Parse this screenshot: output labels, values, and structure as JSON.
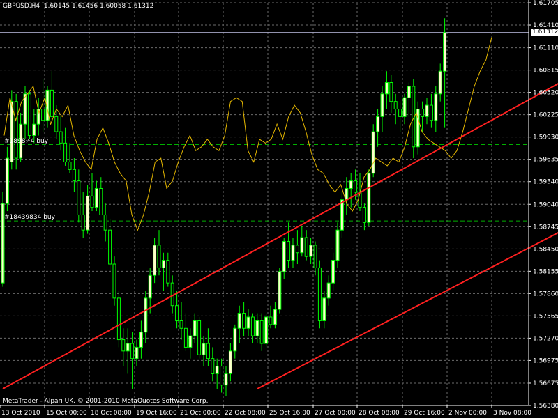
{
  "header": {
    "symbol": "GBPUSD,H4",
    "ohlc": "1.60145 1.61456 1.60058 1.61312"
  },
  "footer": {
    "copyright": "MetaTrader - Alpari UK, © 2001-2010 MetaQuotes Software Corp."
  },
  "bid": {
    "value": "1.61312",
    "price": 1.61312
  },
  "orders": [
    {
      "label": "#1898·⁄·4 buy",
      "price": 1.5983
    },
    {
      "label": "#18439834 buy",
      "price": 1.5882
    }
  ],
  "colors": {
    "background": "#000000",
    "grid": "#6b6b6b",
    "bull_candle": "#ffffcc",
    "bear_candle": "#000000",
    "wick": "#00ff00",
    "indicator": "#e6b800",
    "trendline": "#ff2020",
    "order_line": "#00b000",
    "bid_line": "#a7a7c7",
    "axis_text": "#ffffff"
  },
  "chart_data": {
    "type": "candlestick",
    "symbol": "GBPUSD",
    "timeframe": "H4",
    "y_ticks": [
      "1.61705",
      "1.61410",
      "1.61110",
      "1.60815",
      "1.60520",
      "1.60225",
      "1.59930",
      "1.59635",
      "1.59340",
      "1.59040",
      "1.58745",
      "1.58450",
      "1.58155",
      "1.57860",
      "1.57565",
      "1.57270",
      "1.56975",
      "1.56675",
      "1.56380"
    ],
    "y_range": [
      1.5638,
      1.61705
    ],
    "x_ticks": [
      "13 Oct 2010",
      "15 Oct 00:00",
      "18 Oct 08:00",
      "19 Oct 16:00",
      "21 Oct 00:00",
      "22 Oct 08:00",
      "25 Oct 16:00",
      "27 Oct 00:00",
      "28 Oct 08:00",
      "29 Oct 16:00",
      "2 Nov 00:00",
      "3 Nov 08:00"
    ],
    "candles": [
      [
        1.58,
        1.592,
        1.5795,
        1.5905
      ],
      [
        1.5905,
        1.598,
        1.5895,
        1.5965
      ],
      [
        1.596,
        1.6055,
        1.595,
        1.604
      ],
      [
        1.604,
        1.605,
        1.595,
        1.5965
      ],
      [
        1.5965,
        1.6025,
        1.596,
        1.601
      ],
      [
        1.601,
        1.606,
        1.599,
        1.605
      ],
      [
        1.605,
        1.6055,
        1.599,
        1.5995
      ],
      [
        1.5995,
        1.603,
        1.5985,
        1.601
      ],
      [
        1.601,
        1.6045,
        1.5995,
        1.603
      ],
      [
        1.603,
        1.607,
        1.6,
        1.6015
      ],
      [
        1.6015,
        1.606,
        1.6005,
        1.6055
      ],
      [
        1.6055,
        1.608,
        1.601,
        1.602
      ],
      [
        1.602,
        1.6035,
        1.599,
        1.6
      ],
      [
        1.6,
        1.602,
        1.5975,
        1.5985
      ],
      [
        1.5985,
        1.6005,
        1.5955,
        1.596
      ],
      [
        1.596,
        1.5985,
        1.5945,
        1.595
      ],
      [
        1.595,
        1.5965,
        1.592,
        1.5935
      ],
      [
        1.5935,
        1.595,
        1.588,
        1.589
      ],
      [
        1.589,
        1.592,
        1.586,
        1.587
      ],
      [
        1.587,
        1.593,
        1.5865,
        1.5915
      ],
      [
        1.5915,
        1.5945,
        1.5895,
        1.59
      ],
      [
        1.59,
        1.5935,
        1.5895,
        1.5925
      ],
      [
        1.5925,
        1.594,
        1.589,
        1.589
      ],
      [
        1.589,
        1.5905,
        1.5855,
        1.587
      ],
      [
        1.587,
        1.5885,
        1.5815,
        1.5825
      ],
      [
        1.5825,
        1.5835,
        1.577,
        1.578
      ],
      [
        1.578,
        1.579,
        1.5715,
        1.5725
      ],
      [
        1.5725,
        1.574,
        1.569,
        1.571
      ],
      [
        1.571,
        1.574,
        1.568,
        1.572
      ],
      [
        1.572,
        1.5735,
        1.566,
        1.57
      ],
      [
        1.57,
        1.5725,
        1.569,
        1.5715
      ],
      [
        1.5715,
        1.575,
        1.57,
        1.5735
      ],
      [
        1.5735,
        1.579,
        1.572,
        1.578
      ],
      [
        1.578,
        1.582,
        1.576,
        1.581
      ],
      [
        1.581,
        1.586,
        1.58,
        1.585
      ],
      [
        1.585,
        1.587,
        1.581,
        1.582
      ],
      [
        1.582,
        1.584,
        1.579,
        1.583
      ],
      [
        1.583,
        1.584,
        1.5795,
        1.58
      ],
      [
        1.58,
        1.581,
        1.576,
        1.577
      ],
      [
        1.577,
        1.579,
        1.574,
        1.575
      ],
      [
        1.575,
        1.5775,
        1.5725,
        1.574
      ],
      [
        1.574,
        1.576,
        1.571,
        1.5715
      ],
      [
        1.5715,
        1.574,
        1.57,
        1.573
      ],
      [
        1.573,
        1.576,
        1.572,
        1.575
      ],
      [
        1.575,
        1.5755,
        1.57,
        1.5705
      ],
      [
        1.5705,
        1.573,
        1.569,
        1.572
      ],
      [
        1.572,
        1.574,
        1.569,
        1.57
      ],
      [
        1.57,
        1.5715,
        1.567,
        1.568
      ],
      [
        1.568,
        1.57,
        1.566,
        1.569
      ],
      [
        1.569,
        1.57,
        1.5655,
        1.5665
      ],
      [
        1.5665,
        1.569,
        1.565,
        1.568
      ],
      [
        1.568,
        1.572,
        1.567,
        1.571
      ],
      [
        1.571,
        1.5745,
        1.57,
        1.574
      ],
      [
        1.574,
        1.577,
        1.572,
        1.576
      ],
      [
        1.576,
        1.5775,
        1.573,
        1.574
      ],
      [
        1.574,
        1.5765,
        1.573,
        1.5755
      ],
      [
        1.5755,
        1.576,
        1.572,
        1.573
      ],
      [
        1.573,
        1.576,
        1.572,
        1.575
      ],
      [
        1.575,
        1.576,
        1.571,
        1.572
      ],
      [
        1.572,
        1.576,
        1.5715,
        1.5755
      ],
      [
        1.5755,
        1.577,
        1.574,
        1.5745
      ],
      [
        1.5745,
        1.5775,
        1.574,
        1.5765
      ],
      [
        1.5765,
        1.582,
        1.576,
        1.5815
      ],
      [
        1.5815,
        1.586,
        1.5805,
        1.5855
      ],
      [
        1.5855,
        1.588,
        1.582,
        1.583
      ],
      [
        1.583,
        1.586,
        1.582,
        1.585
      ],
      [
        1.585,
        1.587,
        1.5825,
        1.584
      ],
      [
        1.584,
        1.5875,
        1.5835,
        1.586
      ],
      [
        1.586,
        1.587,
        1.583,
        1.5835
      ],
      [
        1.5835,
        1.586,
        1.5825,
        1.585
      ],
      [
        1.585,
        1.5855,
        1.581,
        1.582
      ],
      [
        1.582,
        1.583,
        1.574,
        1.575
      ],
      [
        1.575,
        1.579,
        1.574,
        1.578
      ],
      [
        1.578,
        1.581,
        1.577,
        1.58
      ],
      [
        1.58,
        1.584,
        1.579,
        1.583
      ],
      [
        1.583,
        1.588,
        1.582,
        1.587
      ],
      [
        1.587,
        1.592,
        1.586,
        1.591
      ],
      [
        1.591,
        1.594,
        1.589,
        1.5925
      ],
      [
        1.5925,
        1.5945,
        1.59,
        1.5935
      ],
      [
        1.5935,
        1.595,
        1.591,
        1.592
      ],
      [
        1.592,
        1.5945,
        1.5895,
        1.59
      ],
      [
        1.59,
        1.5905,
        1.587,
        1.588
      ],
      [
        1.588,
        1.595,
        1.5875,
        1.5945
      ],
      [
        1.5945,
        1.601,
        1.594,
        1.6
      ],
      [
        1.6,
        1.603,
        1.598,
        1.602
      ],
      [
        1.602,
        1.606,
        1.6,
        1.605
      ],
      [
        1.605,
        1.608,
        1.603,
        1.6065
      ],
      [
        1.6065,
        1.6075,
        1.6025,
        1.604
      ],
      [
        1.604,
        1.605,
        1.601,
        1.603
      ],
      [
        1.603,
        1.604,
        1.6,
        1.602
      ],
      [
        1.602,
        1.605,
        1.601,
        1.6045
      ],
      [
        1.6045,
        1.6065,
        1.602,
        1.606
      ],
      [
        1.606,
        1.607,
        1.5965,
        1.598
      ],
      [
        1.598,
        1.604,
        1.597,
        1.603
      ],
      [
        1.603,
        1.604,
        1.6,
        1.602
      ],
      [
        1.602,
        1.6045,
        1.601,
        1.6035
      ],
      [
        1.6035,
        1.605,
        1.6005,
        1.6015
      ],
      [
        1.6015,
        1.606,
        1.6,
        1.605
      ],
      [
        1.605,
        1.609,
        1.604,
        1.608
      ],
      [
        1.608,
        1.615,
        1.6005,
        1.6131
      ]
    ],
    "indicator_line": [
      1.5995,
      1.6045,
      1.6015,
      1.604,
      1.605,
      1.606,
      1.6025,
      1.6045,
      1.601,
      1.603,
      1.602,
      1.6035,
      1.5995,
      1.5975,
      1.596,
      1.595,
      1.599,
      1.6005,
      1.5985,
      1.596,
      1.5945,
      1.5935,
      1.589,
      1.587,
      1.589,
      1.592,
      1.596,
      1.5965,
      1.5925,
      1.5935,
      1.596,
      1.598,
      1.5995,
      1.5975,
      1.598,
      1.599,
      1.598,
      1.5975,
      1.5995,
      1.604,
      1.6045,
      1.604,
      1.5975,
      1.596,
      1.599,
      1.5985,
      1.599,
      1.601,
      1.599,
      1.602,
      1.6035,
      1.6025,
      1.6,
      1.597,
      1.595,
      1.5945,
      1.593,
      1.592,
      1.593,
      1.5905,
      1.5895,
      1.591,
      1.594,
      1.595,
      1.5965,
      1.596,
      1.5955,
      1.5965,
      1.596,
      1.598,
      1.601,
      1.6025,
      1.6,
      1.599,
      1.5985,
      1.598,
      1.5975,
      1.5965,
      1.5975,
      1.6,
      1.603,
      1.606,
      1.608,
      1.6095,
      1.6125
    ],
    "trendlines": [
      {
        "from": [
          0,
          1.566
        ],
        "to": [
          129.5,
          1.608
        ]
      },
      {
        "from": [
          57,
          1.566
        ],
        "to": [
          129.5,
          1.5882
        ]
      }
    ],
    "grid": true
  }
}
